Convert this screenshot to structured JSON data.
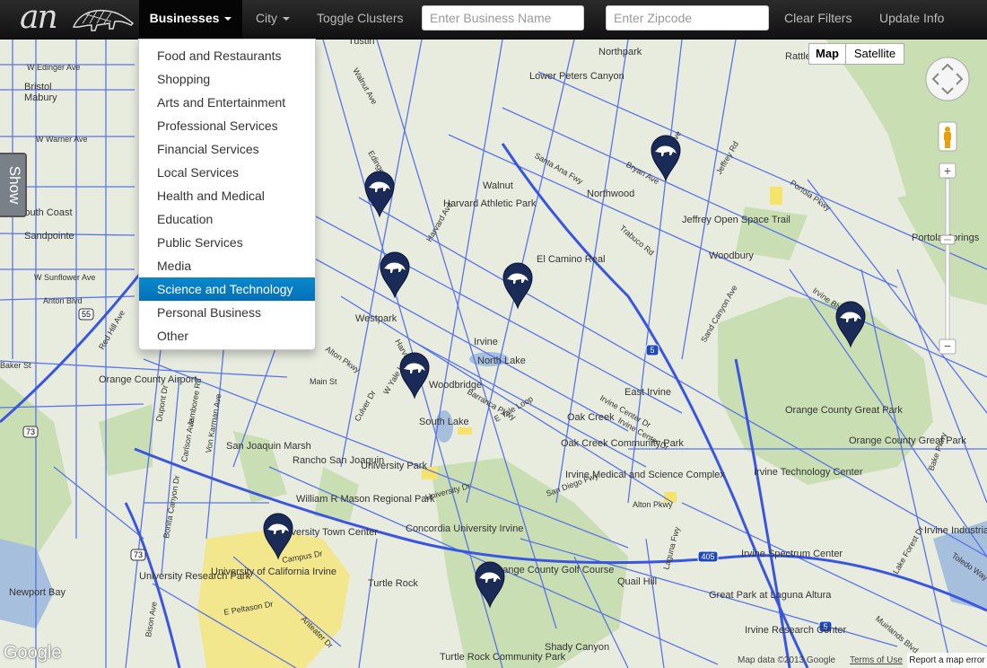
{
  "brand": {
    "text": "an",
    "logo": "anteater-logo-icon"
  },
  "nav": {
    "businesses_label": "Businesses",
    "city_label": "City",
    "toggle_clusters_label": "Toggle Clusters",
    "business_name_placeholder": "Enter Business Name",
    "zipcode_placeholder": "Enter Zipcode",
    "clear_filters_label": "Clear Filters",
    "update_info_label": "Update Info"
  },
  "dropdown": {
    "items": [
      "Food and Restaurants",
      "Shopping",
      "Arts and Entertainment",
      "Professional Services",
      "Financial Services",
      "Local Services",
      "Health and Medical",
      "Education",
      "Public Services",
      "Media",
      "Science and Technology",
      "Personal Business",
      "Other"
    ],
    "active_index": 10
  },
  "map": {
    "type_buttons": [
      "Map",
      "Satellite"
    ],
    "active_type": "Map",
    "show_tab_label": "Show",
    "google_logo_text": "Google",
    "attribution": "Map data ©2013 Google",
    "terms_label": "Terms of Use",
    "report_label": "Report a map error",
    "marker_color": "#1a2b57",
    "labels": [
      {
        "text": "Tustin"
      },
      {
        "text": "W Edinger Ave"
      },
      {
        "text": "Bristol"
      },
      {
        "text": "Mabury"
      },
      {
        "text": "W Warner Ave"
      },
      {
        "text": "South Coast"
      },
      {
        "text": "Sandpointe"
      },
      {
        "text": "W Sunflower Ave"
      },
      {
        "text": "Anton Blvd"
      },
      {
        "text": "Baker St"
      },
      {
        "text": "Orange County Airport"
      },
      {
        "text": "Lower Peters Canyon"
      },
      {
        "text": "Northpark"
      },
      {
        "text": "Rattlesnake Reservoir"
      },
      {
        "text": "Walnut"
      },
      {
        "text": "Harvard Athletic Park"
      },
      {
        "text": "Northwood"
      },
      {
        "text": "Jeffrey Open Space Trail"
      },
      {
        "text": "Woodbury"
      },
      {
        "text": "Portola Springs"
      },
      {
        "text": "El Camino Real"
      },
      {
        "text": "Westpark"
      },
      {
        "text": "Irvine"
      },
      {
        "text": "Woodbridge"
      },
      {
        "text": "North Lake"
      },
      {
        "text": "South Lake"
      },
      {
        "text": "East Irvine"
      },
      {
        "text": "Oak Creek"
      },
      {
        "text": "Orange County Great Park"
      },
      {
        "text": "Orange County Great Park"
      },
      {
        "text": "San Joaquin Marsh"
      },
      {
        "text": "Rancho San Joaquin"
      },
      {
        "text": "University Park"
      },
      {
        "text": "Oak Creek Community Park"
      },
      {
        "text": "Irvine Medical and Science Complex"
      },
      {
        "text": "Irvine Technology Center"
      },
      {
        "text": "Irvine Industrial Complex-East"
      },
      {
        "text": "William R Mason Regional Park"
      },
      {
        "text": "Concordia University Irvine"
      },
      {
        "text": "University Town Center"
      },
      {
        "text": "University of California Irvine"
      },
      {
        "text": "University Research Park"
      },
      {
        "text": "Turtle Rock"
      },
      {
        "text": "Quail Hill"
      },
      {
        "text": "Irvine Spectrum Center"
      },
      {
        "text": "Great Park at Laguna Altura"
      },
      {
        "text": "Irvine Research Center"
      },
      {
        "text": "Shady Canyon"
      },
      {
        "text": "Turtle Rock Community Park"
      },
      {
        "text": "Newport Bay"
      },
      {
        "text": "Orange County Golf Course"
      },
      {
        "text": "Culver Dr"
      },
      {
        "text": "Jeffrey Rd"
      },
      {
        "text": "Yale Ave"
      },
      {
        "text": "Harvard Ave"
      },
      {
        "text": "Alton Pkwy"
      },
      {
        "text": "Barranca Pkwy"
      },
      {
        "text": "Irvine Center Dr"
      },
      {
        "text": "Irvine Blvd"
      },
      {
        "text": "Trabuco Rd"
      },
      {
        "text": "Bryan Ave"
      },
      {
        "text": "Walnut Ave"
      },
      {
        "text": "Edinger Ave"
      },
      {
        "text": "Main St"
      },
      {
        "text": "Jamboree Rd"
      },
      {
        "text": "Campus Dr"
      },
      {
        "text": "University Dr"
      },
      {
        "text": "San Diego Fwy"
      },
      {
        "text": "Sand Canyon Ave"
      },
      {
        "text": "Portola Pkwy"
      },
      {
        "text": "Santa Ana Fwy"
      },
      {
        "text": "Laguna Fwy"
      },
      {
        "text": "Toledo Way"
      },
      {
        "text": "Lake Forest Dr"
      },
      {
        "text": "Muirlands Blvd"
      },
      {
        "text": "Bake Pkwy"
      },
      {
        "text": "Alton Pkwy"
      },
      {
        "text": "Red Hill Ave"
      },
      {
        "text": "Dupont Dr"
      },
      {
        "text": "Von Karman Ave"
      },
      {
        "text": "Carlson Ave"
      },
      {
        "text": "Bison Ave"
      },
      {
        "text": "E Peltason Dr"
      },
      {
        "text": "Anteater Dr"
      },
      {
        "text": "Bonita Canyon Dr"
      },
      {
        "text": "Harvard Ave"
      },
      {
        "text": "W Yale Loop"
      },
      {
        "text": "E Yale Loop"
      },
      {
        "text": "Irvine Center Dr"
      },
      {
        "text": "55"
      },
      {
        "text": "73"
      },
      {
        "text": "5"
      },
      {
        "text": "405"
      }
    ]
  }
}
